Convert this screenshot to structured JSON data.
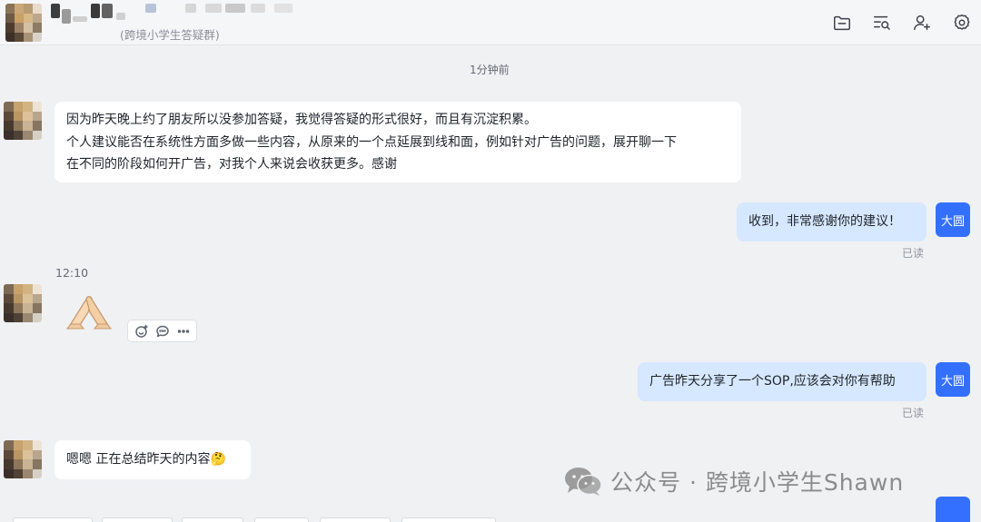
{
  "header": {
    "group_subtitle": "(跨境小学生答疑群)",
    "icons": [
      "folder-icon",
      "search-list-icon",
      "add-member-icon",
      "settings-icon"
    ]
  },
  "timestamps": {
    "first": "1分钟前",
    "second": "12:10"
  },
  "messages": [
    {
      "sender": "other",
      "lines": [
        "因为昨天晚上约了朋友所以没参加答疑，我觉得答疑的形式很好，而且有沉淀积累。",
        "个人建议能否在系统性方面多做一些内容，从原来的一个点延展到线和面，例如针对广告的问题，展开聊一下",
        "在不同的阶段如何开广告，对我个人来说会收获更多。感谢"
      ]
    },
    {
      "sender": "self",
      "avatar_label": "大圆",
      "text": "收到，非常感谢你的建议！",
      "status": "已读"
    },
    {
      "sender": "other",
      "type": "emoji",
      "emoji": "folded-hands"
    },
    {
      "sender": "self",
      "avatar_label": "大圆",
      "text": "广告昨天分享了一个SOP,应该会对你有帮助",
      "status": "已读"
    },
    {
      "sender": "other",
      "text": "嗯嗯 正在总结昨天的内容🤔"
    }
  ],
  "self_avatar_label": "大圆",
  "watermark": "公众号 · 跨境小学生Shawn",
  "colors": {
    "self_bubble": "#d6e8ff",
    "self_avatar": "#3370ff",
    "background": "#f0f1f3"
  }
}
